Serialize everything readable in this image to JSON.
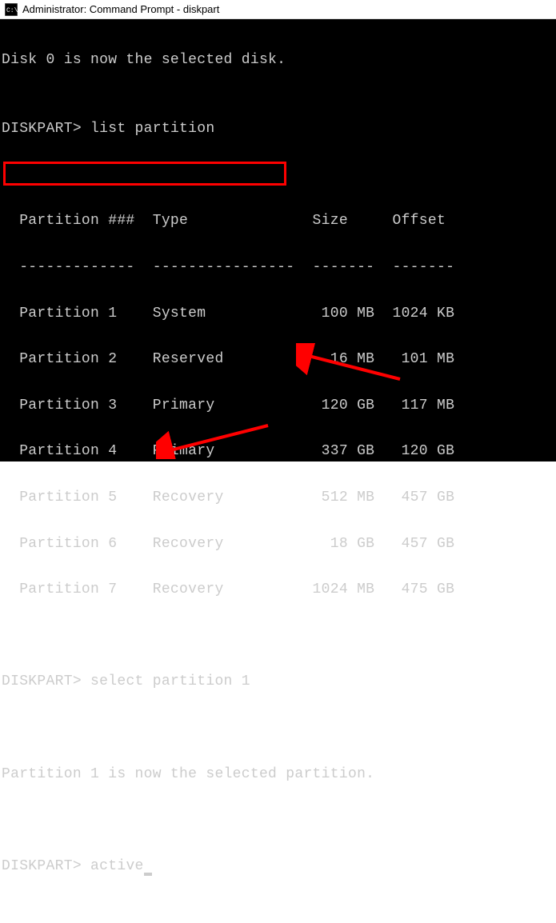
{
  "titlebar": {
    "text": "Administrator: Command Prompt - diskpart"
  },
  "lines": {
    "selected_disk": "Disk 0 is now the selected disk.",
    "blank": "",
    "prompt1_prefix": "DISKPART> ",
    "prompt1_cmd": "list partition",
    "header": "  Partition ###  Type              Size     Offset",
    "dashes": "  -------------  ----------------  -------  -------",
    "rows": [
      "  Partition 1    System             100 MB  1024 KB",
      "  Partition 2    Reserved            16 MB   101 MB",
      "  Partition 3    Primary            120 GB   117 MB",
      "  Partition 4    Primary            337 GB   120 GB",
      "  Partition 5    Recovery           512 MB   457 GB",
      "  Partition 6    Recovery            18 GB   457 GB",
      "  Partition 7    Recovery          1024 MB   475 GB"
    ],
    "prompt2_prefix": "DISKPART> ",
    "prompt2_cmd": "select partition 1",
    "selected_partition": "Partition 1 is now the selected partition.",
    "prompt3_prefix": "DISKPART> ",
    "prompt3_cmd": "active"
  },
  "chart_data": {
    "type": "table",
    "title": "list partition",
    "columns": [
      "Partition ###",
      "Type",
      "Size",
      "Offset"
    ],
    "rows": [
      {
        "partition": "Partition 1",
        "type": "System",
        "size": "100 MB",
        "offset": "1024 KB"
      },
      {
        "partition": "Partition 2",
        "type": "Reserved",
        "size": "16 MB",
        "offset": "101 MB"
      },
      {
        "partition": "Partition 3",
        "type": "Primary",
        "size": "120 GB",
        "offset": "117 MB"
      },
      {
        "partition": "Partition 4",
        "type": "Primary",
        "size": "337 GB",
        "offset": "120 GB"
      },
      {
        "partition": "Partition 5",
        "type": "Recovery",
        "size": "512 MB",
        "offset": "457 GB"
      },
      {
        "partition": "Partition 6",
        "type": "Recovery",
        "size": "18 GB",
        "offset": "457 GB"
      },
      {
        "partition": "Partition 7",
        "type": "Recovery",
        "size": "1024 MB",
        "offset": "475 GB"
      }
    ]
  }
}
